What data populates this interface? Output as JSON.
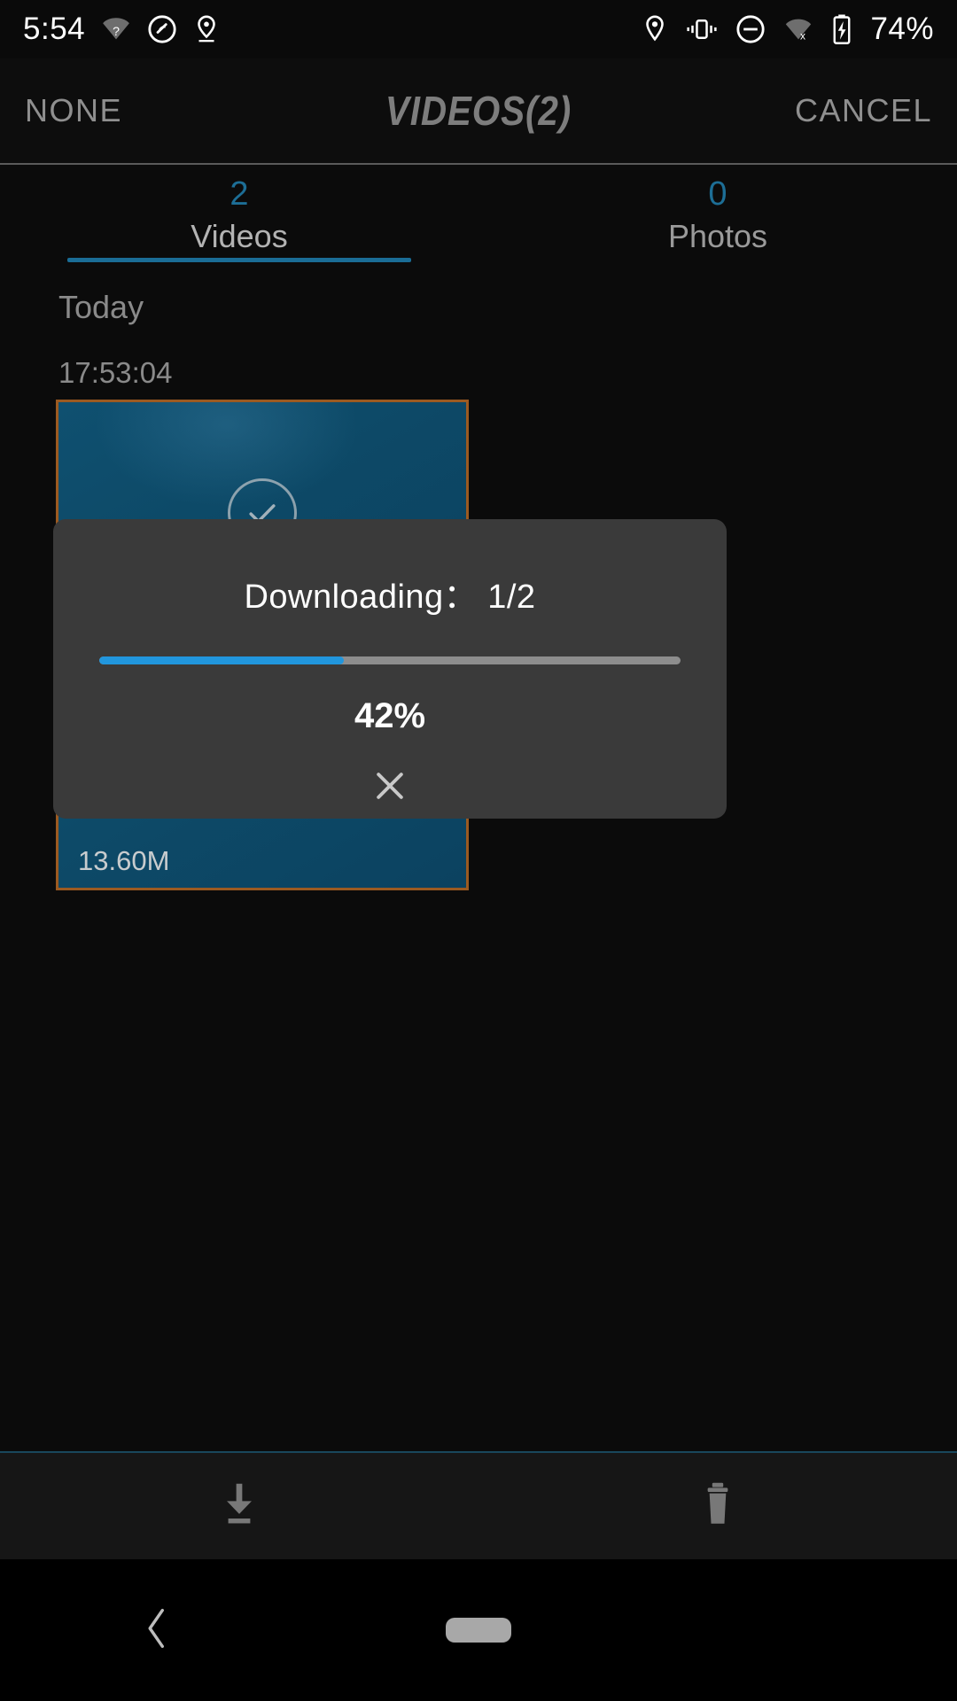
{
  "status_bar": {
    "time": "5:54",
    "battery_percent": "74%",
    "left_icons": [
      "wifi-question-icon",
      "do-not-disturb-circle-icon",
      "location-pin-underline-icon"
    ],
    "right_icons": [
      "location-pin-icon",
      "vibrate-icon",
      "do-not-disturb-icon",
      "wifi-off-icon",
      "battery-charging-icon"
    ]
  },
  "header": {
    "left_button": "NONE",
    "title": "VIDEOS(2)",
    "right_button": "CANCEL"
  },
  "tabs": [
    {
      "count": "2",
      "label": "Videos",
      "active": true
    },
    {
      "count": "0",
      "label": "Photos",
      "active": false
    }
  ],
  "list": {
    "day_header": "Today",
    "items": [
      {
        "timestamp": "17:53:04",
        "size": "",
        "selected": true
      },
      {
        "timestamp": "",
        "size": "13.60M",
        "selected": true
      }
    ]
  },
  "dialog": {
    "title": "Downloading： 1/2",
    "percent_label": "42%",
    "progress": 42,
    "close_icon": "close-icon"
  },
  "bottom_bar": {
    "actions": [
      {
        "icon": "download-icon",
        "name": "download-button"
      },
      {
        "icon": "trash-icon",
        "name": "delete-button"
      }
    ]
  },
  "nav_bar": {
    "back_icon": "back-chevron-icon",
    "home_icon": "home-pill-icon"
  },
  "colors": {
    "accent_blue": "#2196dd",
    "tab_blue": "#1a6d96",
    "selection_border": "#9c5a21",
    "thumb_teal": "#0d4a68",
    "dialog_bg": "#3a3a3a"
  }
}
